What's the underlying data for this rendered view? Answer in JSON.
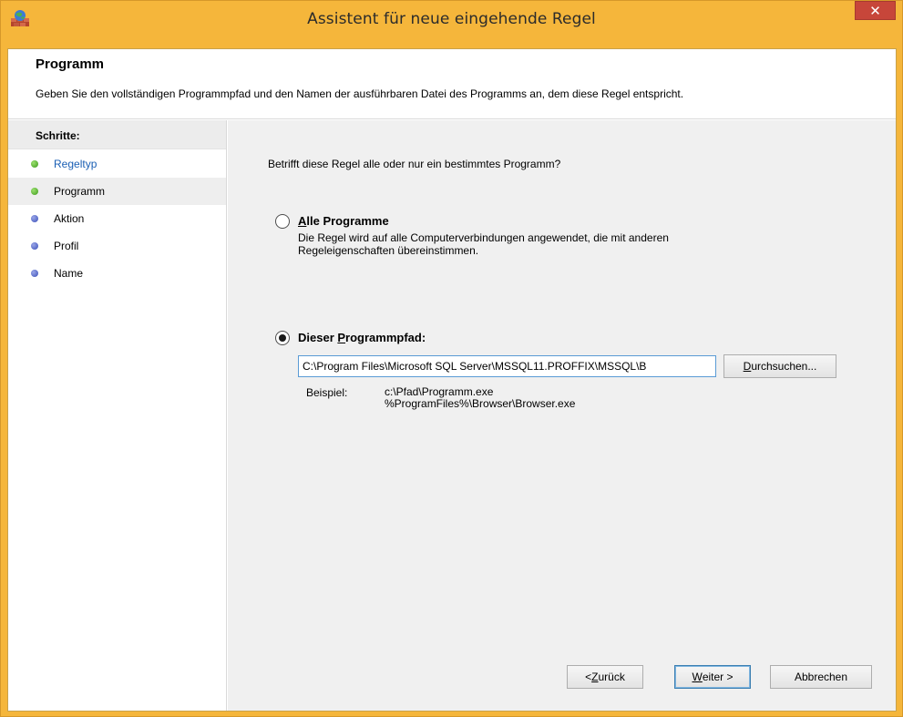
{
  "window": {
    "title": "Assistent für neue eingehende Regel",
    "close_glyph": "✕",
    "icon": "firewall-icon"
  },
  "header": {
    "title": "Programm",
    "description": "Geben Sie den vollständigen Programmpfad und den Namen der ausführbaren Datei des Programms an, dem diese Regel entspricht."
  },
  "sidebar": {
    "heading": "Schritte:",
    "items": [
      {
        "label": "Regeltyp",
        "state": "completed",
        "dot": "green"
      },
      {
        "label": "Programm",
        "state": "current",
        "dot": "green"
      },
      {
        "label": "Aktion",
        "state": "pending",
        "dot": "blue"
      },
      {
        "label": "Profil",
        "state": "pending",
        "dot": "blue"
      },
      {
        "label": "Name",
        "state": "pending",
        "dot": "blue"
      }
    ]
  },
  "main": {
    "question": "Betrifft diese Regel alle oder nur ein bestimmtes Programm?",
    "option_all": {
      "label_underlined": "A",
      "label_rest": "lle Programme",
      "description_line1": "Die Regel wird auf alle Computerverbindungen angewendet, die mit anderen",
      "description_line2": "Regeleigenschaften übereinstimmen.",
      "checked": false
    },
    "option_path": {
      "label_prefix": "Dieser ",
      "label_underlined": "P",
      "label_rest": "rogrammpfad:",
      "checked": true
    },
    "path_value": "C:\\Program Files\\Microsoft SQL Server\\MSSQL11.PROFFIX\\MSSQL\\B",
    "browse_button": {
      "underlined": "D",
      "rest": "urchsuchen..."
    },
    "example": {
      "label": "Beispiel:",
      "line1": "c:\\Pfad\\Programm.exe",
      "line2": "%ProgramFiles%\\Browser\\Browser.exe"
    }
  },
  "footer": {
    "back": {
      "prefix": "< ",
      "underlined": "Z",
      "rest": "urück"
    },
    "next": {
      "underlined": "W",
      "rest": "eiter >"
    },
    "cancel": "Abbrechen"
  },
  "colors": {
    "frame": "#f5b63b",
    "close_button": "#c7463a",
    "link": "#1a5fb4",
    "dot_green": "#3c9a1c",
    "dot_blue": "#3a4fb8"
  }
}
